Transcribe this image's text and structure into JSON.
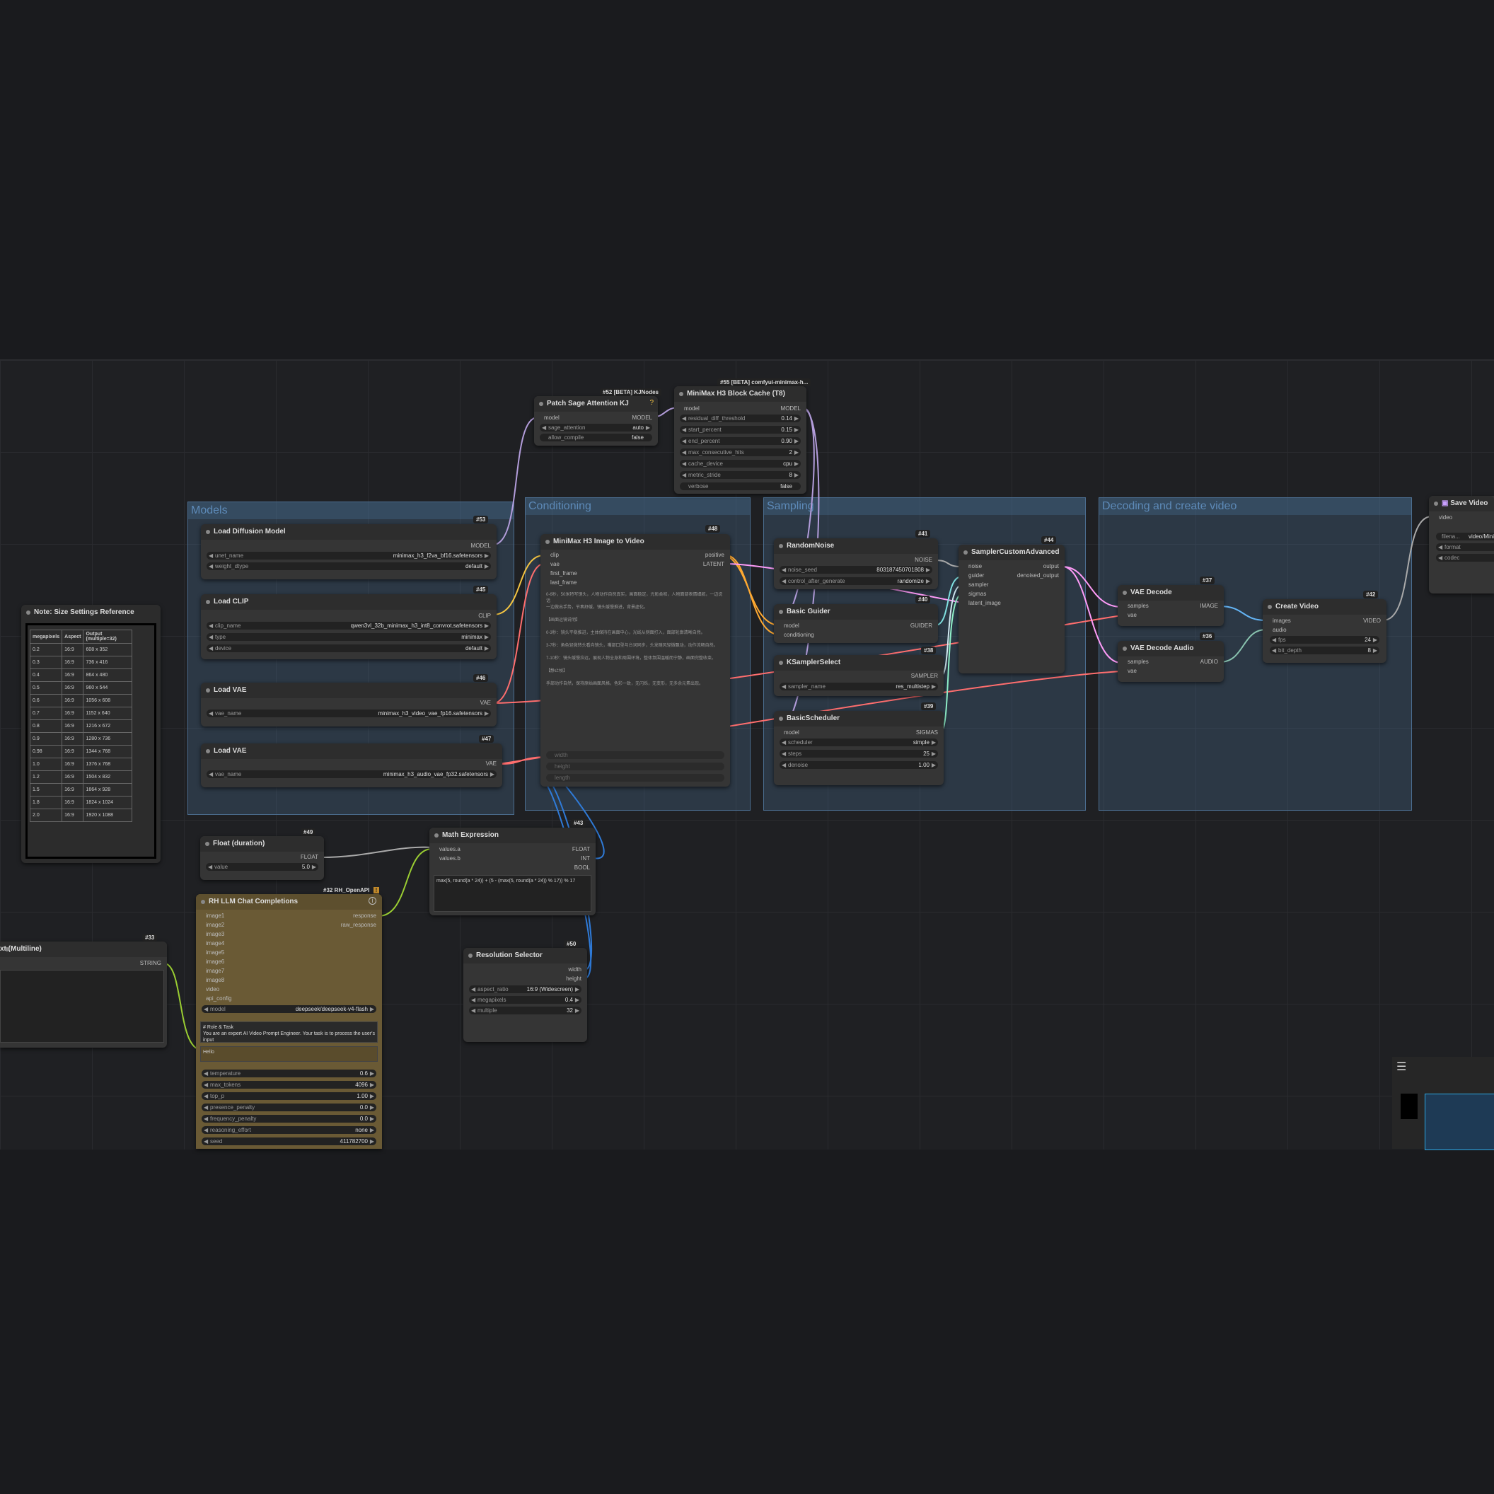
{
  "groups": {
    "models": "Models",
    "conditioning": "Conditioning",
    "sampling": "Sampling",
    "decoding": "Decoding and create video"
  },
  "patch_sage": {
    "badge": "#52 [BETA] KJNodes",
    "title": "Patch Sage Attention KJ",
    "in_model": "model",
    "out_model": "MODEL",
    "w1_label": "sage_attention",
    "w1_value": "auto",
    "w2_label": "allow_compile",
    "w2_value": "false"
  },
  "block_cache": {
    "badge": "#55 [BETA] comfyui-minimax-h...",
    "title": "MiniMax H3 Block Cache (T8)",
    "in_model": "model",
    "out_model": "MODEL",
    "widgets": [
      {
        "label": "residual_diff_threshold",
        "value": "0.14"
      },
      {
        "label": "start_percent",
        "value": "0.15"
      },
      {
        "label": "end_percent",
        "value": "0.90"
      },
      {
        "label": "max_consecutive_hits",
        "value": "2"
      },
      {
        "label": "cache_device",
        "value": "cpu"
      },
      {
        "label": "metric_stride",
        "value": "8"
      },
      {
        "label": "verbose",
        "value": "false"
      }
    ]
  },
  "load_diffusion": {
    "badge": "#53",
    "title": "Load Diffusion Model",
    "out": "MODEL",
    "w1_label": "unet_name",
    "w1_value": "minimax_h3_f2va_bf16.safetensors",
    "w2_label": "weight_dtype",
    "w2_value": "default"
  },
  "load_clip": {
    "badge": "#45",
    "title": "Load CLIP",
    "out": "CLIP",
    "w1_label": "clip_name",
    "w1_value": "qwen3vl_32b_minimax_h3_int8_convrot.safetensors",
    "w2_label": "type",
    "w2_value": "minimax",
    "w3_label": "device",
    "w3_value": "default"
  },
  "load_vae1": {
    "badge": "#46",
    "title": "Load VAE",
    "out": "VAE",
    "w1_label": "vae_name",
    "w1_value": "minimax_h3_video_vae_fp16.safetensors"
  },
  "load_vae2": {
    "badge": "#47",
    "title": "Load VAE",
    "out": "VAE",
    "w1_label": "vae_name",
    "w1_value": "minimax_h3_audio_vae_fp32.safetensors"
  },
  "i2v": {
    "badge": "#48",
    "title": "MiniMax H3 Image to Video",
    "inputs": [
      "clip",
      "vae",
      "first_frame",
      "last_frame"
    ],
    "out_positive": "positive",
    "out_latent": "LATENT",
    "text_lines": [
      "0-6秒，50米特写镜头，人物动作自然真实，画面稳定，光影柔和，人物面部表情细腻，一边说话",
      "一边做出手势，节奏舒缓，镜头缓慢推进，背景虚化。",
      "【画面运镜说明】",
      "0-3秒：镜头平稳推进，主体保持在画面中心，光线从侧面打入，面部轮廓清晰自然。",
      "3-7秒：角色轻微转头看向镜头，嘴部口型与台词同步，头发随风轻微飘动，动作流畅自然。",
      "7-10秒：镜头缓慢拉远，展现人物全身和周围环境，整体氛围温暖而宁静，画面完整收束。",
      "【静止帧】",
      "手部动作自然，保持原始画面风格，色彩一致，无闪烁，无变形，无多余元素出现。"
    ],
    "extra": [
      "width",
      "height",
      "length"
    ]
  },
  "random_noise": {
    "badge": "#41",
    "title": "RandomNoise",
    "out": "NOISE",
    "w1_label": "noise_seed",
    "w1_value": "803187450701808",
    "w2_label": "control_after_generate",
    "w2_value": "randomize"
  },
  "basic_guider": {
    "badge": "#40",
    "title": "Basic Guider",
    "out": "GUIDER",
    "in1": "model",
    "in2": "conditioning"
  },
  "ksampler_select": {
    "badge": "#38",
    "title": "KSamplerSelect",
    "out": "SAMPLER",
    "w1_label": "sampler_name",
    "w1_value": "res_multistep"
  },
  "basic_scheduler": {
    "badge": "#39",
    "title": "BasicScheduler",
    "out": "SIGMAS",
    "in1": "model",
    "w1_label": "scheduler",
    "w1_value": "simple",
    "w2_label": "steps",
    "w2_value": "25",
    "w3_label": "denoise",
    "w3_value": "1.00"
  },
  "sampler_adv": {
    "badge": "#44",
    "title": "SamplerCustomAdvanced",
    "inputs": [
      "noise",
      "guider",
      "sampler",
      "sigmas",
      "latent_image"
    ],
    "out1": "output",
    "out2": "denoised_output"
  },
  "vae_decode": {
    "badge": "#37",
    "title": "VAE Decode",
    "out": "IMAGE",
    "in1": "samples",
    "in2": "vae"
  },
  "vae_decode_audio": {
    "badge": "#36",
    "title": "VAE Decode Audio",
    "out": "AUDIO",
    "in1": "samples",
    "in2": "vae"
  },
  "create_video": {
    "badge": "#42",
    "title": "Create Video",
    "out": "VIDEO",
    "in1": "images",
    "in2": "audio",
    "w1_label": "fps",
    "w1_value": "24",
    "w2_label": "bit_depth",
    "w2_value": "8"
  },
  "save_video": {
    "title": "Save Video",
    "in1": "video",
    "w1_label": "filena...",
    "w1_value": "video/Mini",
    "w2_label": "format",
    "w3_label": "codec"
  },
  "note": {
    "title": "Note: Size Settings Reference",
    "headers": [
      "megapixels",
      "Aspect",
      "Output (multiple=32)"
    ],
    "rows": [
      [
        "0.2",
        "16:9",
        "608 x 352"
      ],
      [
        "0.3",
        "16:9",
        "736 x 416"
      ],
      [
        "0.4",
        "16:9",
        "864 x 480"
      ],
      [
        "0.5",
        "16:9",
        "960 x 544"
      ],
      [
        "0.6",
        "16:9",
        "1056 x 608"
      ],
      [
        "0.7",
        "16:9",
        "1152 x 640"
      ],
      [
        "0.8",
        "16:9",
        "1216 x 672"
      ],
      [
        "0.9",
        "16:9",
        "1280 x 736"
      ],
      [
        "0.98",
        "16:9",
        "1344 x 768"
      ],
      [
        "1.0",
        "16:9",
        "1376 x 768"
      ],
      [
        "1.2",
        "16:9",
        "1504 x 832"
      ],
      [
        "1.5",
        "16:9",
        "1664 x 928"
      ],
      [
        "1.8",
        "16:9",
        "1824 x 1024"
      ],
      [
        "2.0",
        "16:9",
        "1920 x 1088"
      ]
    ]
  },
  "float_duration": {
    "badge": "#49",
    "title": "Float (duration)",
    "out": "FLOAT",
    "w1_label": "value",
    "w1_value": "5.0"
  },
  "math_expr": {
    "badge": "#43",
    "title": "Math Expression",
    "in1": "values.a",
    "in2": "values.b",
    "out1": "FLOAT",
    "out2": "INT",
    "out3": "BOOL",
    "expression": "max(5, round(a * 24)) + (5 - (max(5, round(a * 24)) % 17)) % 17"
  },
  "llm_chat": {
    "badge": "#32 RH_OpenAPI",
    "title": "RH LLM Chat Completions",
    "inputs": [
      "image1",
      "image2",
      "image3",
      "image4",
      "image5",
      "image6",
      "image7",
      "image8",
      "video",
      "api_config"
    ],
    "out1": "response",
    "out2": "raw_response",
    "model_label": "model",
    "model_value": "deepseek/deepseek-v4-flash",
    "prompt_title": "# Role & Task",
    "prompt_text": "You are an expert AI Video Prompt Engineer. Your task is to process the user's input",
    "user_text": "Hello",
    "widgets": [
      {
        "label": "temperature",
        "value": "0.6"
      },
      {
        "label": "max_tokens",
        "value": "4096"
      },
      {
        "label": "top_p",
        "value": "1.00"
      },
      {
        "label": "presence_penalty",
        "value": "0.0"
      },
      {
        "label": "frequency_penalty",
        "value": "0.0"
      },
      {
        "label": "reasoning_effort",
        "value": "none"
      },
      {
        "label": "seed",
        "value": "411782700"
      }
    ]
  },
  "text_multiline": {
    "badge": "#33",
    "title": "xt (Multiline)",
    "out": "STRING"
  },
  "resolution": {
    "badge": "#50",
    "title": "Resolution Selector",
    "out1": "width",
    "out2": "height",
    "w1_label": "aspect_ratio",
    "w1_value": "16:9 (Widescreen)",
    "w2_label": "megapixels",
    "w2_value": "0.4",
    "w3_label": "multiple",
    "w3_value": "32"
  },
  "colors": {
    "model": "#b39ddb",
    "clip": "#f5c542",
    "vae": "#ff6e6e",
    "conditioning": "#ffa931",
    "latent": "#ff9cf9",
    "float": "#aaaaaa",
    "string": "#9acd32",
    "int": "#2f7bd9",
    "image": "#64b5f6",
    "audio": "#8ac4b0"
  },
  "icons": {
    "settings": "sliders-icon"
  }
}
